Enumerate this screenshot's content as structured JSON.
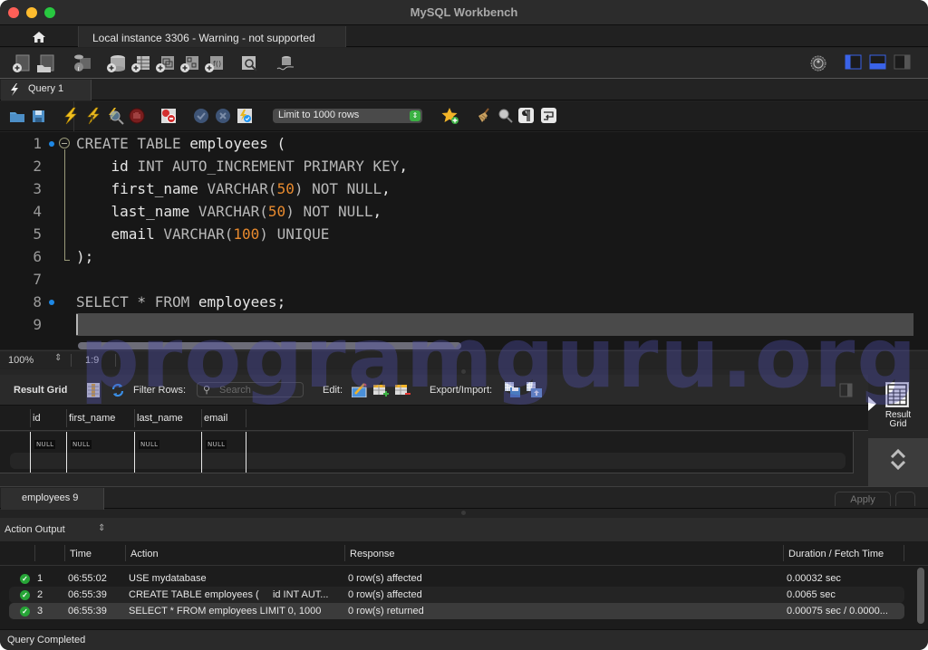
{
  "window": {
    "title": "MySQL Workbench"
  },
  "connection_tabs": {
    "home_icon": "home-icon",
    "active_tab": "Local instance 3306 - Warning - not supported"
  },
  "main_toolbar": {
    "left_icons": [
      "new-sql-tab-icon",
      "open-sql-script-icon",
      "schema-inspector-icon",
      "create-schema-icon",
      "create-table-icon",
      "create-view-icon",
      "create-procedure-icon",
      "create-function-icon",
      "search-table-data-icon",
      "reconnect-icon"
    ],
    "right_icons": [
      "preferences-gear-icon",
      "toggle-sidebar-icon",
      "toggle-output-panel-icon",
      "toggle-secondary-sidebar-icon"
    ]
  },
  "query_tabs": [
    {
      "label": "Query 1",
      "icon": "bolt-icon",
      "active": true
    }
  ],
  "sql_toolbar": {
    "icons_left": [
      "open-file-icon",
      "save-file-icon",
      "execute-all-icon",
      "execute-current-icon",
      "explain-icon",
      "stop-icon",
      "toggle-stop-on-error-icon",
      "commit-icon",
      "rollback-icon",
      "autocommit-icon"
    ],
    "limit_select": "Limit to 1000 rows",
    "icons_right": [
      "add-snippet-icon",
      "beautify-icon",
      "find-icon",
      "invisible-characters-icon",
      "word-wrap-icon"
    ]
  },
  "editor": {
    "lines": [
      {
        "n": "1",
        "marker": true
      },
      {
        "n": "2"
      },
      {
        "n": "3"
      },
      {
        "n": "4"
      },
      {
        "n": "5"
      },
      {
        "n": "6"
      },
      {
        "n": "7"
      },
      {
        "n": "8",
        "marker": true
      },
      {
        "n": "9"
      }
    ],
    "code": {
      "l1_kw": "CREATE TABLE",
      "l1_rest": " employees (",
      "l2_id": "    id ",
      "l2_kw": "INT AUTO_INCREMENT PRIMARY KEY",
      "l2_end": ",",
      "l3_col": "    first_name ",
      "l3_kw": "VARCHAR(",
      "l3_num": "50",
      "l3_kw2": ") NOT NULL",
      "l3_end": ",",
      "l4_col": "    last_name ",
      "l4_kw": "VARCHAR(",
      "l4_num": "50",
      "l4_kw2": ") NOT NULL",
      "l4_end": ",",
      "l5_col": "    email ",
      "l5_kw": "VARCHAR(",
      "l5_num": "100",
      "l5_kw2": ") UNIQUE",
      "l6": ");",
      "l8_kw": "SELECT",
      "l8_star": " * ",
      "l8_kw2": "FROM",
      "l8_rest": " employees;"
    },
    "status": {
      "zoom": "100%",
      "cursor": "1:9"
    }
  },
  "result": {
    "toolbar": {
      "title": "Result Grid",
      "filter_label": "Filter Rows:",
      "search_placeholder": "Search",
      "edit_label": "Edit:",
      "export_label": "Export/Import:"
    },
    "columns": [
      "id",
      "first_name",
      "last_name",
      "email"
    ],
    "rows": [
      [
        "NULL",
        "NULL",
        "NULL",
        "NULL"
      ]
    ],
    "side_panel": {
      "result_grid_label_1": "Result",
      "result_grid_label_2": "Grid"
    },
    "tabs": [
      {
        "label": "employees 9",
        "active": true
      }
    ],
    "apply_label": "Apply"
  },
  "output": {
    "selector_label": "Action Output",
    "columns": [
      "",
      "",
      "Time",
      "Action",
      "Response",
      "Duration / Fetch Time"
    ],
    "rows": [
      {
        "status": "success",
        "n": "1",
        "time": "06:55:02",
        "action": "USE mydatabase",
        "response": "0 row(s) affected",
        "duration": "0.00032 sec"
      },
      {
        "status": "success",
        "n": "2",
        "time": "06:55:39",
        "action": "CREATE TABLE employees (     id INT AUT...",
        "response": "0 row(s) affected",
        "duration": "0.0065 sec"
      },
      {
        "status": "success",
        "n": "3",
        "time": "06:55:39",
        "action": "SELECT * FROM employees LIMIT 0, 1000",
        "response": "0 row(s) returned",
        "duration": "0.00075 sec / 0.0000..."
      }
    ]
  },
  "status_bar": {
    "text": "Query Completed"
  },
  "watermark": {
    "text": "programguru.org"
  },
  "colors": {
    "accent_blue": "#1e88e5",
    "number_literal": "#e88a2e",
    "success_green": "#27a537",
    "limit_stepper_green": "#3bb143"
  }
}
